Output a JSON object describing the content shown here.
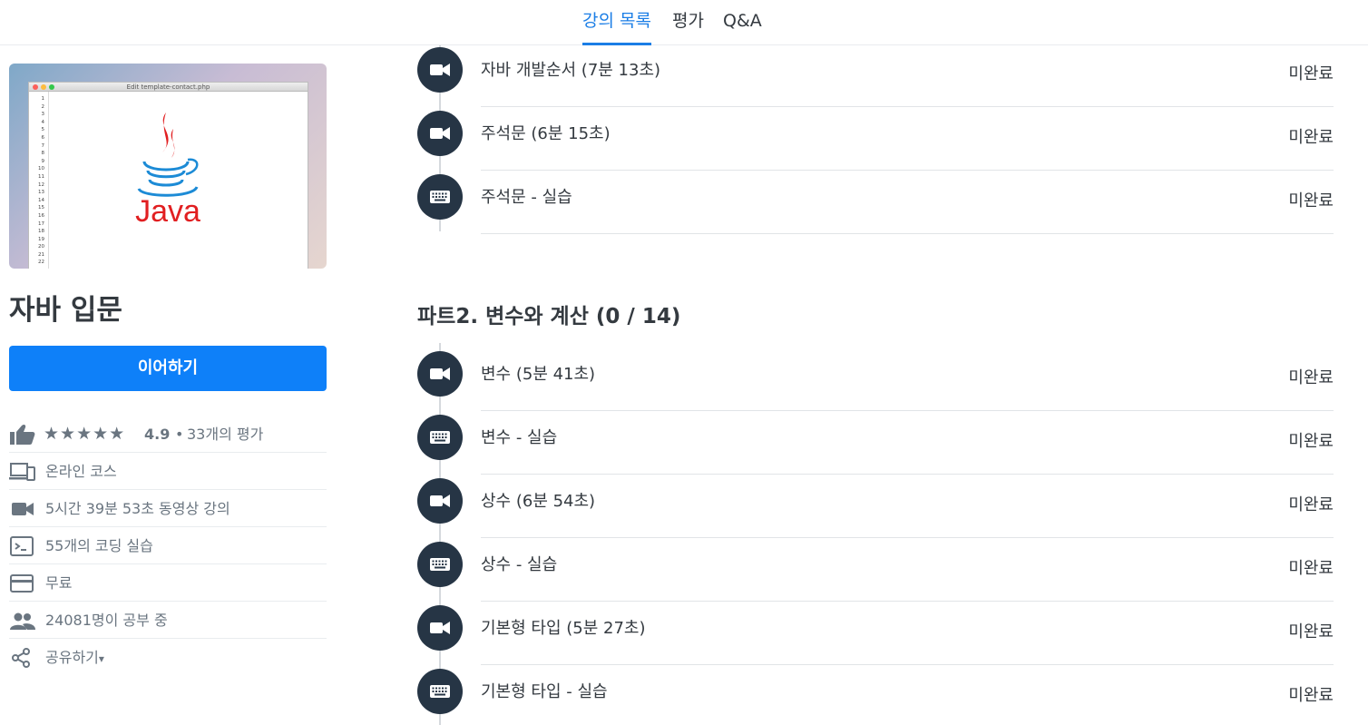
{
  "tabs": [
    {
      "label": "강의 목록",
      "active": true
    },
    {
      "label": "평가",
      "active": false
    },
    {
      "label": "Q&A",
      "active": false
    }
  ],
  "course": {
    "title": "자바 입문",
    "continue_label": "이어하기",
    "thumbnail": {
      "window_title": "Edit template-contact.php",
      "logo_text": "Java",
      "line_numbers": [
        "1",
        "2",
        "3",
        "4",
        "5",
        "6",
        "7",
        "8",
        "9",
        "10",
        "11",
        "12",
        "13",
        "14",
        "15",
        "16",
        "17",
        "18",
        "19",
        "20",
        "21",
        "22"
      ]
    },
    "rating": {
      "stars": "★★★★★",
      "score": "4.9",
      "bullet": "•",
      "reviews": "33개의 평가"
    },
    "info": {
      "type": "온라인 코스",
      "video": "5시간 39분 53초 동영상 강의",
      "coding": "55개의 코딩 실습",
      "price": "무료",
      "students": "24081명이 공부 중",
      "share": "공유하기",
      "share_caret": "▾"
    }
  },
  "colors": {
    "accent": "#1b7ee6",
    "button": "#0e80f9",
    "icon_circle": "#263545",
    "muted_text": "#6a7580"
  },
  "part1_lessons": [
    {
      "title": "자바 개발순서 (7분 13초)",
      "status": "미완료",
      "icon": "video-camera-icon"
    },
    {
      "title": "주석문 (6분 15초)",
      "status": "미완료",
      "icon": "video-camera-icon"
    },
    {
      "title": "주석문 - 실습",
      "status": "미완료",
      "icon": "keyboard-icon"
    }
  ],
  "part2": {
    "title": "파트2. 변수와 계산 (0 / 14)",
    "lessons": [
      {
        "title": "변수 (5분 41초)",
        "status": "미완료",
        "icon": "video-camera-icon"
      },
      {
        "title": "변수 - 실습",
        "status": "미완료",
        "icon": "keyboard-icon"
      },
      {
        "title": "상수 (6분 54초)",
        "status": "미완료",
        "icon": "video-camera-icon"
      },
      {
        "title": "상수 - 실습",
        "status": "미완료",
        "icon": "keyboard-icon"
      },
      {
        "title": "기본형 타입 (5분 27초)",
        "status": "미완료",
        "icon": "video-camera-icon"
      },
      {
        "title": "기본형 타입 - 실습",
        "status": "미완료",
        "icon": "keyboard-icon"
      }
    ]
  }
}
